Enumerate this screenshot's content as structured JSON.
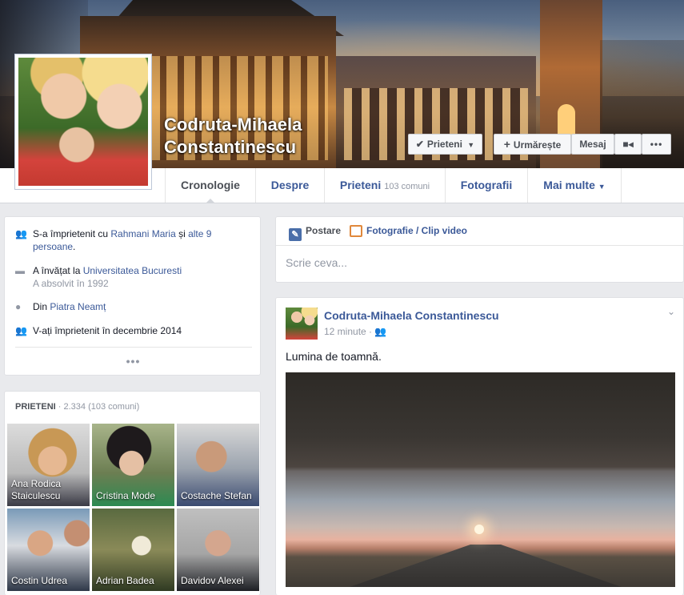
{
  "profile": {
    "name": "Codruta-Mihaela Constantinescu"
  },
  "actions": {
    "friends_label": "Prieteni",
    "follow_label": "Urmărește",
    "message_label": "Mesaj"
  },
  "nav": {
    "tabs": [
      {
        "label": "Cronologie"
      },
      {
        "label": "Despre"
      },
      {
        "label": "Prieteni",
        "count": "103 comuni"
      },
      {
        "label": "Fotografii"
      },
      {
        "label": "Mai multe"
      }
    ]
  },
  "intro": {
    "friends_prefix": "S-a împrietenit cu ",
    "friend_link": "Rahmani Maria",
    "and": " și ",
    "others_link": "alte 9 persoane",
    "period": ".",
    "studied_prefix": "A învățat la ",
    "university": "Universitatea Bucuresti",
    "graduated": "A absolvit în 1992",
    "from_prefix": "Din ",
    "hometown": "Piatra Neamț",
    "friends_since": "V-ați împrietenit în decembrie 2014",
    "more_dots": "•••"
  },
  "friends_panel": {
    "title": "PRIETENI",
    "count": " · 2.334 (103 comuni)",
    "items": [
      {
        "name": "Ana Rodica Staiculescu"
      },
      {
        "name": "Cristina Mode"
      },
      {
        "name": "Costache Stefan"
      },
      {
        "name": "Costin Udrea"
      },
      {
        "name": "Adrian Badea"
      },
      {
        "name": "Davidov Alexei"
      }
    ]
  },
  "composer": {
    "post_tab": "Postare",
    "photo_tab": "Fotografie / Clip video",
    "placeholder": "Scrie ceva..."
  },
  "post": {
    "author": "Codruta-Mihaela Constantinescu",
    "time": "12 minute",
    "text": "Lumina de toamnă."
  },
  "icons": {
    "check": "check-icon",
    "caret": "caret-down-icon",
    "plus": "plus-icon",
    "video": "video-camera-icon",
    "more": "more-dots-icon",
    "friends": "friends-icon",
    "education": "graduation-cap-icon",
    "location": "location-pin-icon",
    "audience": "friends-audience-icon",
    "post": "pencil-icon",
    "photo": "photo-icon"
  },
  "colors": {
    "link": "#3b5998",
    "background": "#e9eaed",
    "muted": "#9197a3"
  }
}
